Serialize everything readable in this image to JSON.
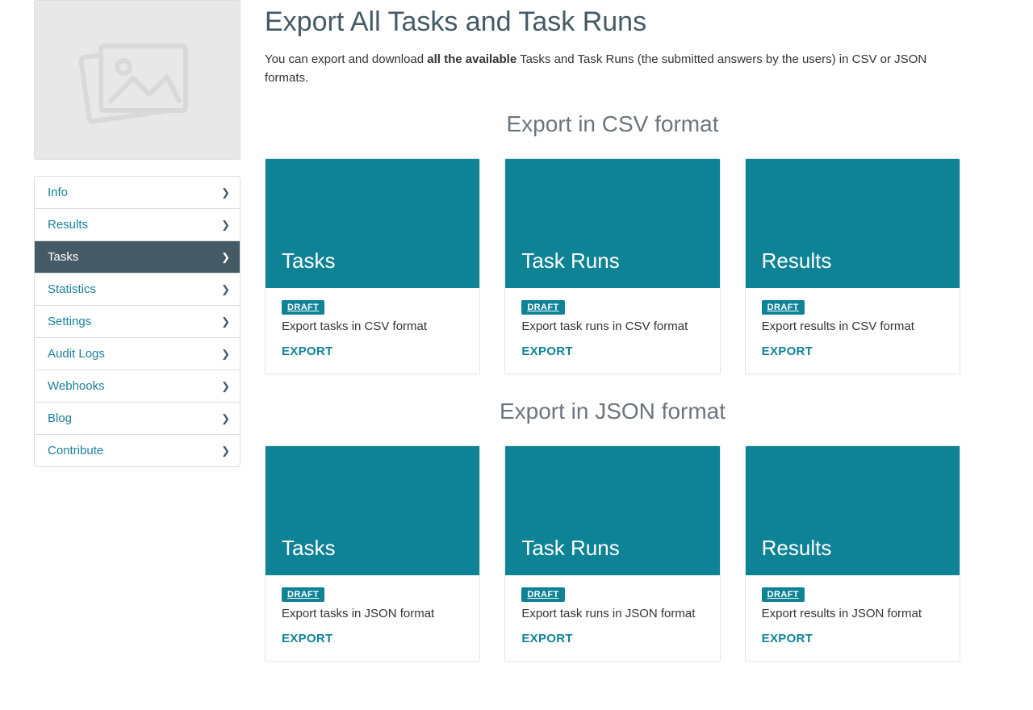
{
  "page": {
    "title": "Export All Tasks and Task Runs",
    "lead_pre": "You can export and download ",
    "lead_bold": "all the available",
    "lead_post": " Tasks and Task Runs (the submitted answers by the users) in CSV or JSON formats."
  },
  "sidebar": {
    "items": [
      {
        "label": "Info",
        "active": false
      },
      {
        "label": "Results",
        "active": false
      },
      {
        "label": "Tasks",
        "active": true
      },
      {
        "label": "Statistics",
        "active": false
      },
      {
        "label": "Settings",
        "active": false
      },
      {
        "label": "Audit Logs",
        "active": false
      },
      {
        "label": "Webhooks",
        "active": false
      },
      {
        "label": "Blog",
        "active": false
      },
      {
        "label": "Contribute",
        "active": false
      }
    ]
  },
  "sections": {
    "csv": {
      "heading": "Export in CSV format",
      "cards": [
        {
          "title": "Tasks",
          "badge": "DRAFT",
          "desc": "Export tasks in CSV format",
          "action": "EXPORT"
        },
        {
          "title": "Task Runs",
          "badge": "DRAFT",
          "desc": "Export task runs in CSV format",
          "action": "EXPORT"
        },
        {
          "title": "Results",
          "badge": "DRAFT",
          "desc": "Export results in CSV format",
          "action": "EXPORT"
        }
      ]
    },
    "json": {
      "heading": "Export in JSON format",
      "cards": [
        {
          "title": "Tasks",
          "badge": "DRAFT",
          "desc": "Export tasks in JSON format",
          "action": "EXPORT"
        },
        {
          "title": "Task Runs",
          "badge": "DRAFT",
          "desc": "Export task runs in JSON format",
          "action": "EXPORT"
        },
        {
          "title": "Results",
          "badge": "DRAFT",
          "desc": "Export results in JSON format",
          "action": "EXPORT"
        }
      ]
    }
  },
  "colors": {
    "accent": "#0f8396",
    "sidebar_active": "#455a64",
    "link": "#1b809e"
  }
}
